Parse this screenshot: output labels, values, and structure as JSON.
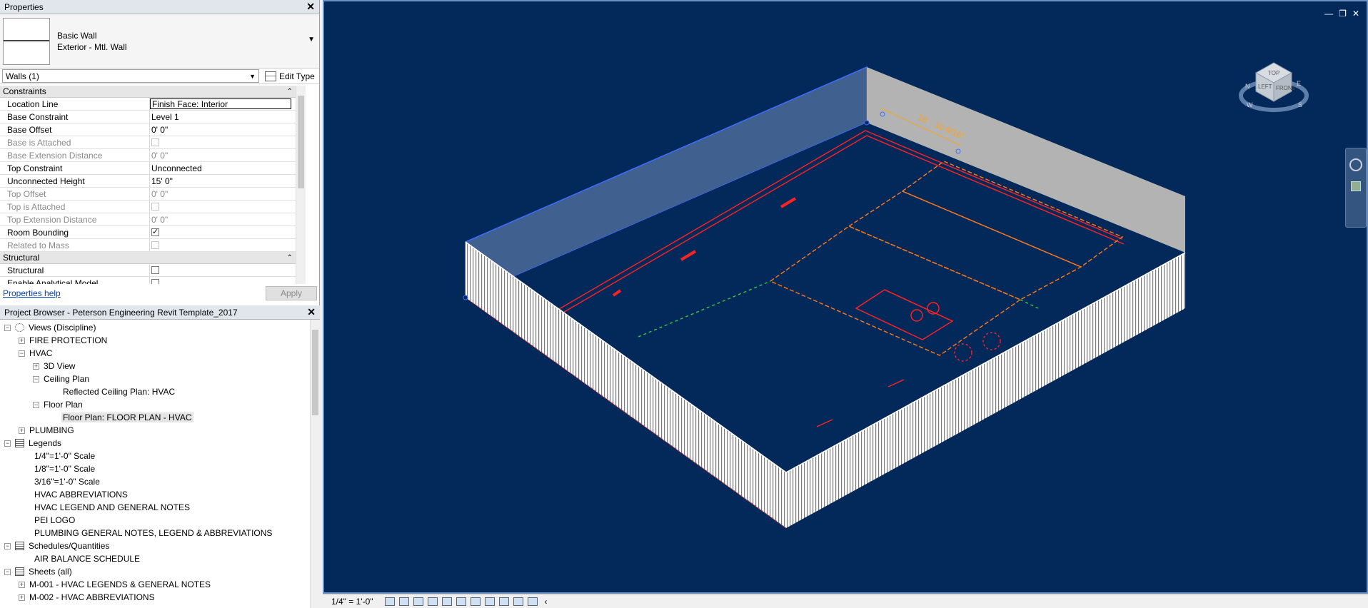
{
  "properties": {
    "title": "Properties",
    "close": "✕",
    "family": "Basic Wall",
    "type": "Exterior - Mtl. Wall",
    "instance_selector": "Walls (1)",
    "edit_type": "Edit Type",
    "help_link": "Properties help",
    "apply": "Apply",
    "groups": {
      "constraints": "Constraints",
      "structural": "Structural"
    },
    "rows": [
      {
        "label": "Location Line",
        "value": "Finish Face: Interior"
      },
      {
        "label": "Base Constraint",
        "value": "Level 1"
      },
      {
        "label": "Base Offset",
        "value": "0'  0\""
      },
      {
        "label": "Base is Attached",
        "value": ""
      },
      {
        "label": "Base Extension Distance",
        "value": "0'  0\""
      },
      {
        "label": "Top Constraint",
        "value": "Unconnected"
      },
      {
        "label": "Unconnected Height",
        "value": "15'  0\""
      },
      {
        "label": "Top Offset",
        "value": "0'  0\""
      },
      {
        "label": "Top is Attached",
        "value": ""
      },
      {
        "label": "Top Extension Distance",
        "value": "0'  0\""
      },
      {
        "label": "Room Bounding",
        "value": ""
      },
      {
        "label": "Related to Mass",
        "value": ""
      }
    ],
    "structural_rows": [
      {
        "label": "Structural",
        "value": ""
      },
      {
        "label": "Enable Analytical Model",
        "value": ""
      }
    ]
  },
  "project_browser": {
    "title": "Project Browser - Peterson Engineering Revit Template_2017",
    "close": "✕",
    "nodes": [
      {
        "label": "Views (Discipline)"
      },
      {
        "label": "FIRE PROTECTION"
      },
      {
        "label": "HVAC"
      },
      {
        "label": "3D View"
      },
      {
        "label": "Ceiling Plan"
      },
      {
        "label": "Reflected Ceiling Plan: HVAC"
      },
      {
        "label": "Floor Plan"
      },
      {
        "label": "Floor Plan: FLOOR PLAN - HVAC"
      },
      {
        "label": "PLUMBING"
      },
      {
        "label": "Legends"
      },
      {
        "label": "1/4\"=1'-0\" Scale"
      },
      {
        "label": "1/8\"=1'-0\" Scale"
      },
      {
        "label": "3/16\"=1'-0\" Scale"
      },
      {
        "label": "HVAC ABBREVIATIONS"
      },
      {
        "label": "HVAC LEGEND AND GENERAL NOTES"
      },
      {
        "label": "PEI LOGO"
      },
      {
        "label": "PLUMBING GENERAL NOTES, LEGEND & ABBREVIATIONS"
      },
      {
        "label": "Schedules/Quantities"
      },
      {
        "label": "AIR BALANCE SCHEDULE"
      },
      {
        "label": "Sheets (all)"
      },
      {
        "label": "M-001 - HVAC LEGENDS & GENERAL NOTES"
      },
      {
        "label": "M-002 - HVAC ABBREVIATIONS"
      }
    ]
  },
  "viewport": {
    "dimension": "18' - 10 9/16\"",
    "viewcube": {
      "top": "TOP",
      "left": "LEFT",
      "front": "FRONT",
      "n": "N",
      "e": "E",
      "s": "S",
      "w": "W"
    },
    "window_controls": [
      "—",
      "❐",
      "✕"
    ]
  },
  "status_bar": {
    "scale": "1/4\" = 1'-0\""
  },
  "colors": {
    "viewport_bg": "#03295a",
    "wall": "#ffffff",
    "linework": "#ff1a1a",
    "dimension": "#f5a623"
  }
}
